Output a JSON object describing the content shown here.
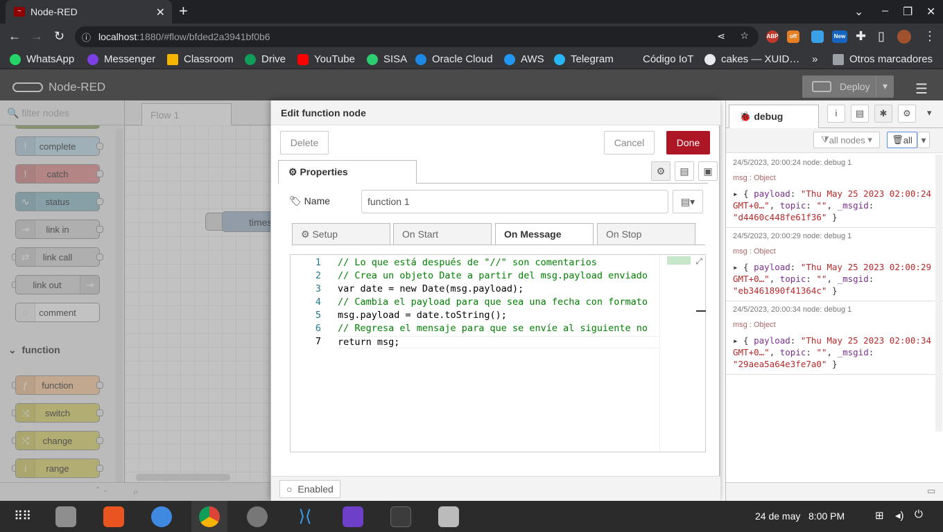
{
  "browser": {
    "tab_title": "Node-RED",
    "url_host": "localhost",
    "url_path": ":1880/#flow/bfded2a3941bf0b6",
    "bookmarks": [
      "WhatsApp",
      "Messenger",
      "Classroom",
      "Drive",
      "YouTube",
      "SISA",
      "Oracle Cloud",
      "AWS",
      "Telegram",
      "Código IoT",
      "cakes — XUID…"
    ],
    "other_bookmarks": "Otros marcadores",
    "ext_new": "New",
    "ext_abp": "ABP",
    "ext_off": "off"
  },
  "header": {
    "title": "Node-RED",
    "deploy": "Deploy"
  },
  "palette": {
    "filter_placeholder": "filter nodes",
    "nodes_top": [
      "complete",
      "catch",
      "status",
      "link in",
      "link call",
      "link out",
      "comment"
    ],
    "category": "function",
    "nodes_fn": [
      "function",
      "switch",
      "change",
      "range"
    ]
  },
  "workspace": {
    "tab": "Flow 1",
    "node_label": "times"
  },
  "editor": {
    "title": "Edit function node",
    "delete": "Delete",
    "cancel": "Cancel",
    "done": "Done",
    "properties_tab": "Properties",
    "name_label": "Name",
    "name_value": "function 1",
    "tabs": [
      "Setup",
      "On Start",
      "On Message",
      "On Stop"
    ],
    "code_lines": [
      "// Lo que está después de \"//\" son comentarios",
      "// Crea un objeto Date a partir del msg.payload enviado",
      "var date = new Date(msg.payload);",
      "// Cambia el payload para que sea una fecha con formato",
      "msg.payload = date.toString();",
      "// Regresa el mensaje para que se envíe al siguiente no",
      "return msg;"
    ],
    "line_numbers": [
      "1",
      "2",
      "3",
      "4",
      "5",
      "6",
      "7"
    ],
    "enabled": "Enabled"
  },
  "sidebar": {
    "tab": "debug",
    "filter": "all nodes",
    "clear": "all",
    "messages": [
      {
        "meta": "24/5/2023, 20:00:24   node: debug 1",
        "type": "msg : Object",
        "payload": "\"Thu May 25 2023 02:00:24 GMT+0…\"",
        "topic": "\"\"",
        "msgid": "\"d4460c448fe61f36\""
      },
      {
        "meta": "24/5/2023, 20:00:29   node: debug 1",
        "type": "msg : Object",
        "payload": "\"Thu May 25 2023 02:00:29 GMT+0…\"",
        "topic": "\"\"",
        "msgid": "\"eb3461890f41364c\""
      },
      {
        "meta": "24/5/2023, 20:00:34   node: debug 1",
        "type": "msg : Object",
        "payload": "\"Thu May 25 2023 02:00:34 GMT+0…\"",
        "topic": "\"\"",
        "msgid": "\"29aea5a64e3fe7a0\""
      }
    ]
  },
  "taskbar": {
    "date": "24 de may",
    "time": "8:00 PM"
  }
}
